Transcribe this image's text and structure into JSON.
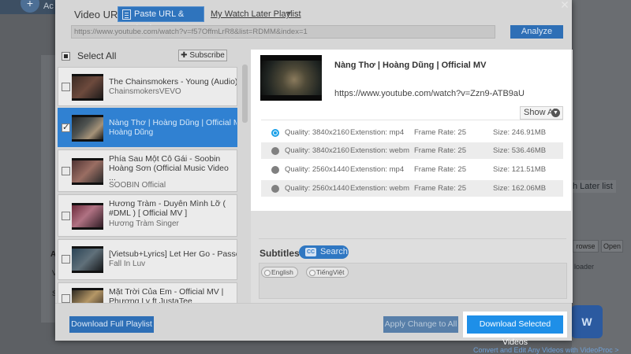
{
  "background": {
    "logo_text": "Ac",
    "later_list": "h Later list",
    "browse": "rowse",
    "open": "Open",
    "loader": "loader",
    "promo": "Convert and Edit Any Videos with VideoProc >",
    "left_a": "A",
    "left_v": "V",
    "left_s": "S"
  },
  "header": {
    "url_label": "Video URL:",
    "paste_button": "Paste URL & Analyze",
    "watch_later": "My Watch Later Playlist",
    "url_value": "https://www.youtube.com/watch?v=f57OffmLrR8&list=RDMM&index=1",
    "analyze_button": "Analyze"
  },
  "list": {
    "select_all": "Select All",
    "subscribe": "Subscribe",
    "items": [
      {
        "title": "The Chainsmokers - Young (Audio)",
        "channel": "ChainsmokersVEVO"
      },
      {
        "title": "Nàng Thơ | Hoàng Dũng | Official MV",
        "channel": "Hoàng Dũng"
      },
      {
        "title": "Phía Sau Một Cô Gái - Soobin Hoàng Sơn (Official Music Video ...",
        "channel": "SOOBIN Official"
      },
      {
        "title": "Hương Tràm - Duyên Mình Lỡ ( #DML ) [ Official MV ]",
        "channel": "Hương Tràm Singer"
      },
      {
        "title": "[Vietsub+Lyrics] Let Her Go - Passenger",
        "channel": "Fall In Luv"
      },
      {
        "title": "Mặt Trời Của Em - Official MV | Phương Ly ft JustaTee",
        "channel": ""
      }
    ]
  },
  "detail": {
    "title": "Nàng Thơ | Hoàng Dũng | Official MV",
    "url": "https://www.youtube.com/watch?v=Zzn9-ATB9aU",
    "show_all": "Show All",
    "formats": [
      {
        "quality": "Quality: 3840x2160",
        "ext": "Extenstion: mp4",
        "fr": "Frame Rate: 25",
        "size": "Size: 246.91MB"
      },
      {
        "quality": "Quality: 3840x2160",
        "ext": "Extenstion: webm",
        "fr": "Frame Rate: 25",
        "size": "Size: 536.46MB"
      },
      {
        "quality": "Quality: 2560x1440",
        "ext": "Extenstion: mp4",
        "fr": "Frame Rate: 25",
        "size": "Size: 121.51MB"
      },
      {
        "quality": "Quality: 2560x1440",
        "ext": "Extenstion: webm",
        "fr": "Frame Rate: 25",
        "size": "Size: 162.06MB"
      }
    ]
  },
  "subtitles": {
    "label": "Subtitles",
    "search": "Search",
    "cc": "CC",
    "languages": [
      "English",
      "TiếngViệt"
    ]
  },
  "footer": {
    "download_playlist": "Download Full Playlist",
    "apply_change": "Apply Change to All",
    "download_selected": "Download Selected Videos"
  }
}
